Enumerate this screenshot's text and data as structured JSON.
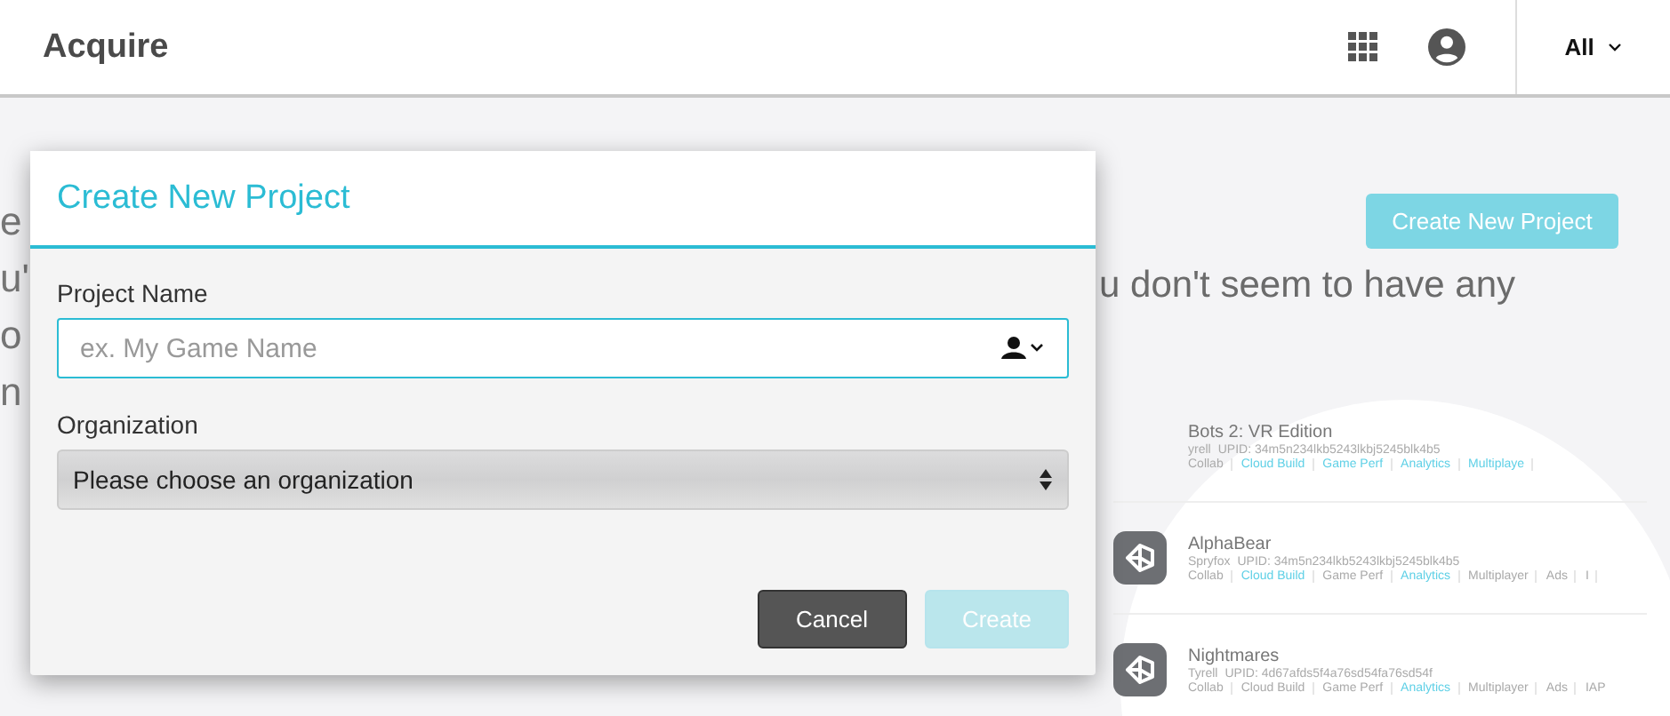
{
  "header": {
    "title": "Acquire",
    "filter": "All"
  },
  "background_fragments": [
    "e",
    "u'",
    "o",
    "n"
  ],
  "create_button": "Create New Project",
  "empty_message": "u don't seem to have any",
  "projects": [
    {
      "name": "Bots 2: VR Edition",
      "org": "yrell",
      "upid": "UPID: 34m5n234lkb5243lkbj5245blk4b5",
      "show_icon": false,
      "services": [
        {
          "label": "Collab",
          "active": false
        },
        {
          "label": "Cloud Build",
          "active": true
        },
        {
          "label": "Game Perf",
          "active": true
        },
        {
          "label": "Analytics",
          "active": true
        },
        {
          "label": "Multiplaye",
          "active": true
        }
      ]
    },
    {
      "name": "AlphaBear",
      "org": "Spryfox",
      "upid": "UPID: 34m5n234lkb5243lkbj5245blk4b5",
      "show_icon": true,
      "services": [
        {
          "label": "Collab",
          "active": false
        },
        {
          "label": "Cloud Build",
          "active": true
        },
        {
          "label": "Game Perf",
          "active": false
        },
        {
          "label": "Analytics",
          "active": true
        },
        {
          "label": "Multiplayer",
          "active": false
        },
        {
          "label": "Ads",
          "active": false
        },
        {
          "label": "I",
          "active": false
        }
      ]
    },
    {
      "name": "Nightmares",
      "org": "Tyrell",
      "upid": "UPID: 4d67afds5f4a76sd54fa76sd54f",
      "show_icon": true,
      "services": [
        {
          "label": "Collab",
          "active": false
        },
        {
          "label": "Cloud Build",
          "active": false
        },
        {
          "label": "Game Perf",
          "active": false
        },
        {
          "label": "Analytics",
          "active": true
        },
        {
          "label": "Multiplayer",
          "active": false
        },
        {
          "label": "Ads",
          "active": false
        },
        {
          "label": "IAP",
          "active": false
        }
      ]
    }
  ],
  "dialog": {
    "title": "Create New Project",
    "name_label": "Project Name",
    "name_placeholder": "ex. My Game Name",
    "org_label": "Organization",
    "org_value": "Please choose an organization",
    "buttons": [
      {
        "label": "Cancel",
        "kind": "secondary",
        "disabled": false
      },
      {
        "label": "Create",
        "kind": "primary",
        "disabled": true
      }
    ]
  }
}
